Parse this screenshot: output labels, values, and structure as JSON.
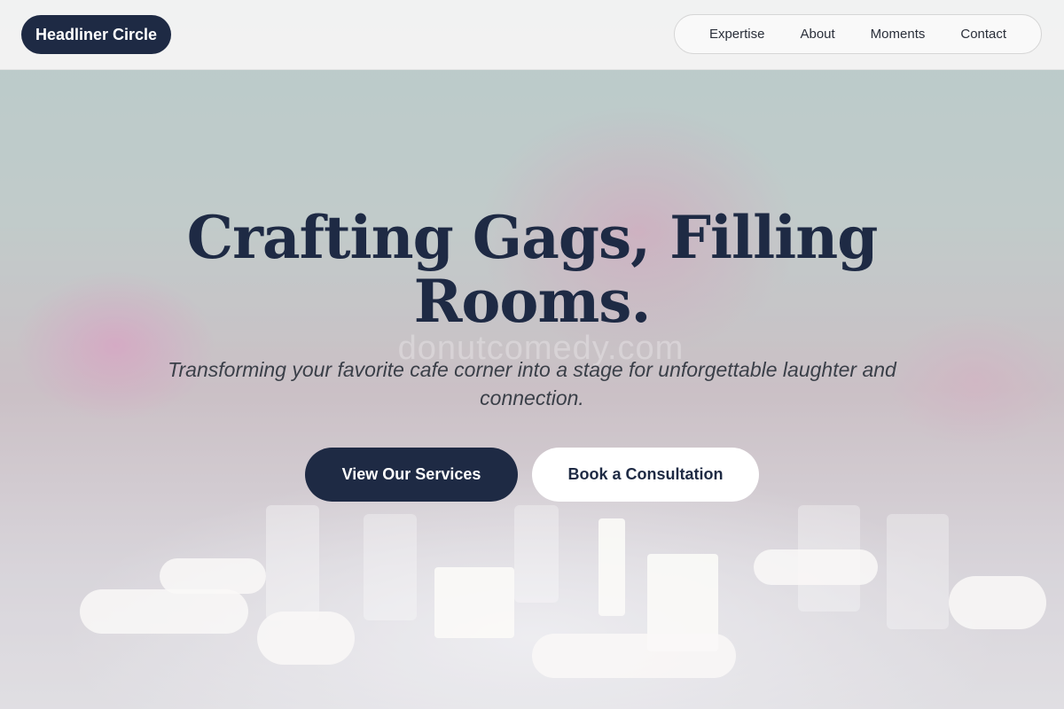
{
  "header": {
    "brand": "Headliner Circle",
    "nav": [
      "Expertise",
      "About",
      "Moments",
      "Contact"
    ]
  },
  "hero": {
    "headline": "Crafting Gags, Filling Rooms.",
    "subtitle": "Transforming your favorite cafe corner into a stage for unforgettable laughter and connection.",
    "watermark": "donutcomedy.com",
    "primary_cta": "View Our Services",
    "secondary_cta": "Book a Consultation"
  },
  "colors": {
    "brand_navy": "#1e2a44",
    "header_bg": "#f4f4f4",
    "button_light": "#ffffff"
  }
}
